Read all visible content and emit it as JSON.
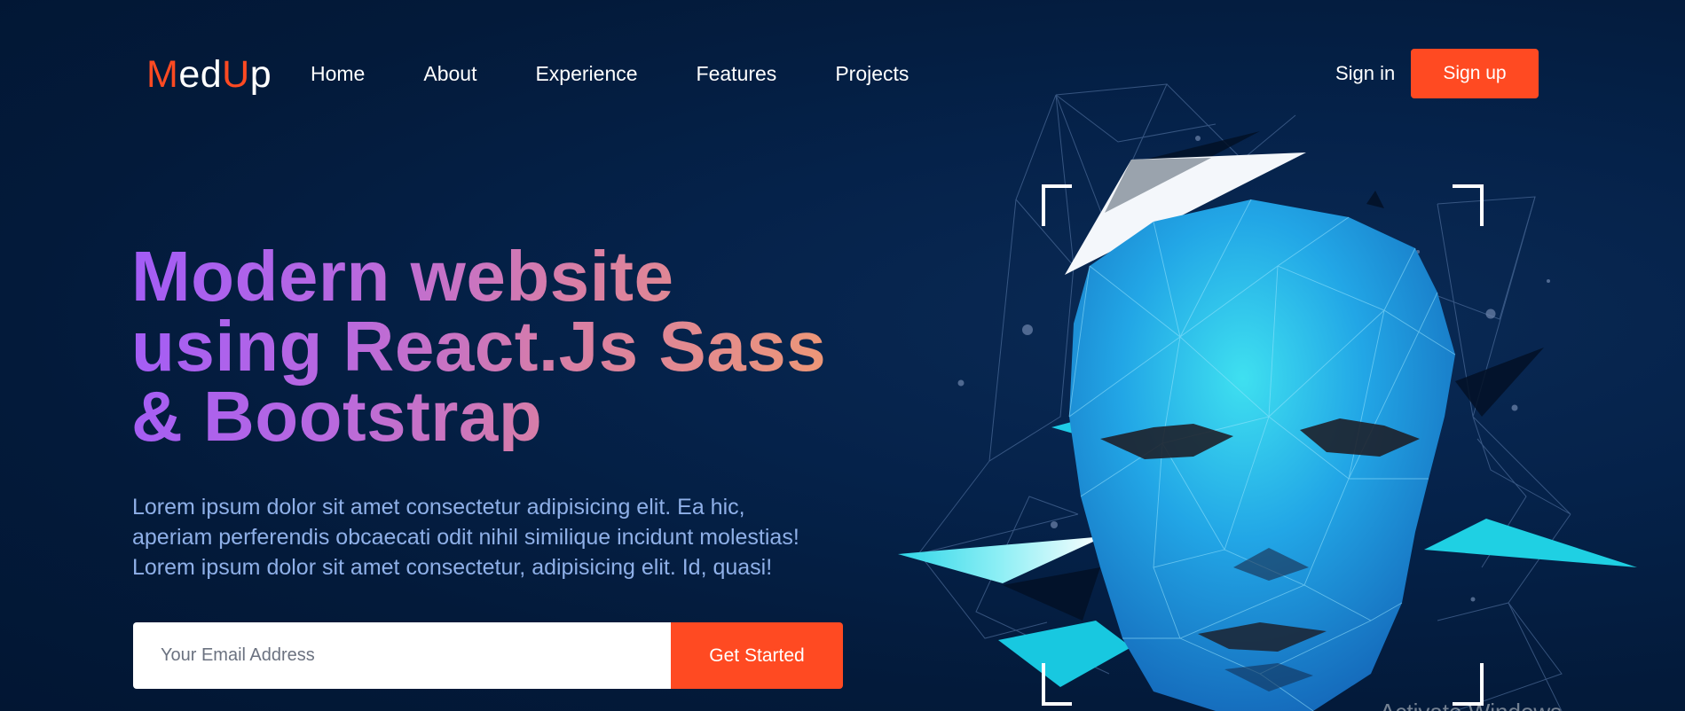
{
  "brand": {
    "logo_parts": [
      "M",
      "ed",
      "U",
      "p"
    ],
    "accent_color": "#ff4a22"
  },
  "nav": {
    "links": [
      "Home",
      "About",
      "Experience",
      "Features",
      "Projects"
    ],
    "signin_label": "Sign in",
    "signup_label": "Sign up"
  },
  "hero": {
    "title_lines": [
      "Modern website",
      "using React.Js Sass",
      "& Bootstrap"
    ],
    "description_lines": [
      "Lorem ipsum dolor sit amet consectetur adipisicing elit. Ea hic,",
      "aperiam perferendis obcaecati odit nihil similique incidunt molestias!",
      "Lorem ipsum dolor sit amet consectetur, adipisicing elit. Id, quasi!"
    ],
    "email_placeholder": "Your Email Address",
    "cta_label": "Get Started",
    "art_icon": "low-poly-face-illustration"
  },
  "watermark_text": "Activate Windows",
  "colors": {
    "background": "#041a3c",
    "primary_button": "#ff4a22",
    "description_text": "#8fb0e8"
  }
}
